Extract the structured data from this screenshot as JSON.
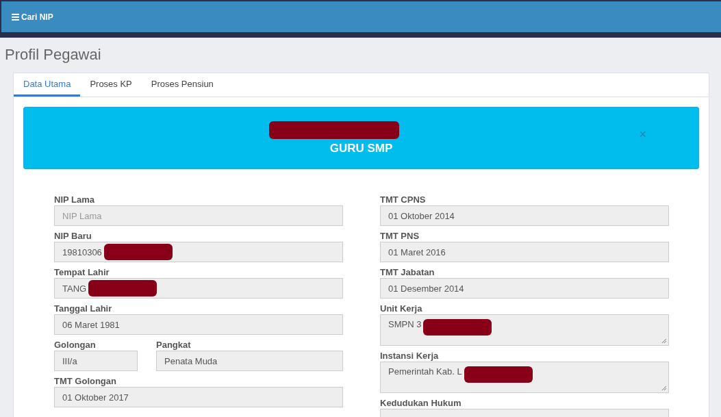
{
  "navbar": {
    "label": "Cari NIP"
  },
  "page_title": "Profil Pegawai",
  "tabs": [
    {
      "label": "Data Utama",
      "selected": true
    },
    {
      "label": "Proses KP",
      "selected": false
    },
    {
      "label": "Proses Pensiun",
      "selected": false
    }
  ],
  "banner": {
    "name_redacted": true,
    "title": "GURU SMP",
    "close": "×"
  },
  "left_fields": [
    {
      "kind": "input",
      "label": "NIP Lama",
      "placeholder": "NIP Lama"
    },
    {
      "kind": "input",
      "label": "NIP Baru",
      "value": "19810306",
      "redacted": true
    },
    {
      "kind": "input",
      "label": "Tempat Lahir",
      "value": "TANG",
      "redacted": true
    },
    {
      "kind": "input",
      "label": "Tanggal Lahir",
      "value": "06 Maret 1981"
    },
    {
      "kind": "pair",
      "items": [
        {
          "label": "Golongan",
          "value": "III/a"
        },
        {
          "label": "Pangkat",
          "value": "Penata Muda"
        }
      ]
    },
    {
      "kind": "input",
      "label": "TMT Golongan",
      "value": "01 Oktober 2017"
    }
  ],
  "right_fields": [
    {
      "kind": "input",
      "label": "TMT CPNS",
      "value": "01 Oktober 2014"
    },
    {
      "kind": "input",
      "label": "TMT PNS",
      "value": "01 Maret 2016"
    },
    {
      "kind": "input",
      "label": "TMT Jabatan",
      "value": "01 Desember 2014"
    },
    {
      "kind": "textarea",
      "label": "Unit Kerja",
      "value": "SMPN 3",
      "redacted": true
    },
    {
      "kind": "textarea",
      "label": "Instansi Kerja",
      "value": "Pemerintah Kab. L",
      "redacted": true
    },
    {
      "kind": "input",
      "label": "Kedudukan Hukum"
    }
  ]
}
